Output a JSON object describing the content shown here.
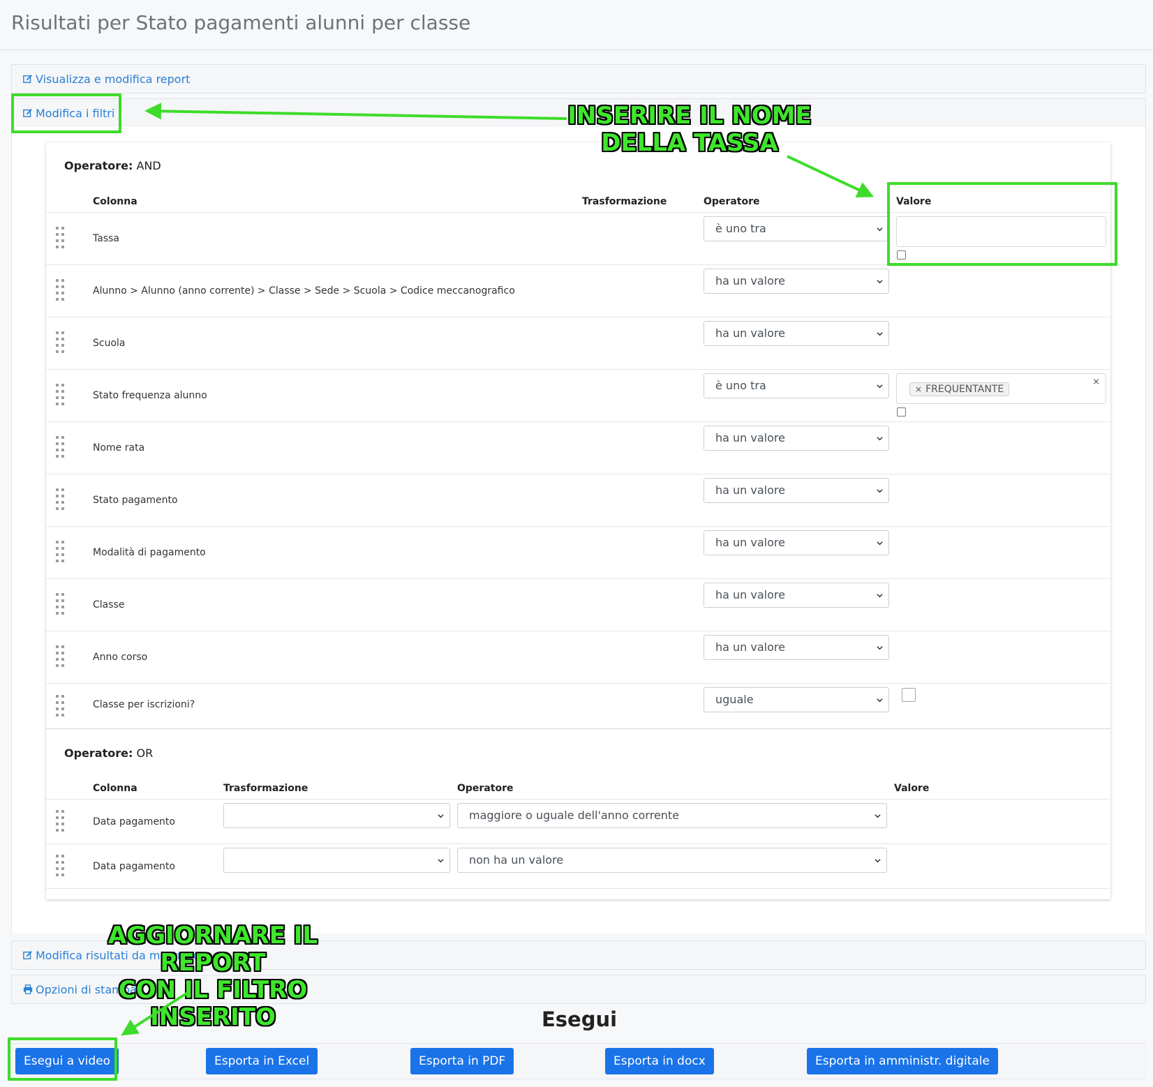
{
  "page": {
    "title": "Risultati per Stato pagamenti alunni per classe"
  },
  "panels": {
    "view_report": "Visualizza e modifica report",
    "edit_filters": "Modifica i filtri",
    "edit_results": "Modifica risultati da mostrare",
    "print_options": "Opzioni di stampa"
  },
  "and_group": {
    "title_label": "Operatore:",
    "title_value": "AND",
    "headers": {
      "column": "Colonna",
      "transform": "Trasformazione",
      "operator": "Operatore",
      "value": "Valore"
    },
    "rows": [
      {
        "column": "Tassa",
        "operator": "è uno tra"
      },
      {
        "column": "Alunno > Alunno (anno corrente) > Classe > Sede > Scuola > Codice meccanografico",
        "operator": "ha un valore"
      },
      {
        "column": "Scuola",
        "operator": "ha un valore"
      },
      {
        "column": "Stato frequenza alunno",
        "operator": "è uno tra",
        "tag": "FREQUENTANTE",
        "tag_remove": "×",
        "clear": "×"
      },
      {
        "column": "Nome rata",
        "operator": "ha un valore"
      },
      {
        "column": "Stato pagamento",
        "operator": "ha un valore"
      },
      {
        "column": "Modalità di pagamento",
        "operator": "ha un valore"
      },
      {
        "column": "Classe",
        "operator": "ha un valore"
      },
      {
        "column": "Anno corso",
        "operator": "ha un valore"
      },
      {
        "column": "Classe per iscrizioni?",
        "operator": "uguale"
      }
    ]
  },
  "or_group": {
    "title_label": "Operatore:",
    "title_value": "OR",
    "headers": {
      "column": "Colonna",
      "transform": "Trasformazione",
      "operator": "Operatore",
      "value": "Valore"
    },
    "rows": [
      {
        "column": "Data pagamento",
        "transform": "",
        "operator": "maggiore o uguale dell'anno corrente"
      },
      {
        "column": "Data pagamento",
        "transform": "",
        "operator": "non ha un valore"
      }
    ]
  },
  "run": {
    "title": "Esegui",
    "buttons": {
      "video": "Esegui a video",
      "excel": "Esporta in Excel",
      "pdf": "Esporta in PDF",
      "docx": "Esporta in docx",
      "digital": "Esporta in amministr. digitale"
    }
  },
  "annotations": {
    "tax_name_line1": "INSERIRE IL NOME",
    "tax_name_line2": "DELLA TASSA",
    "refresh_line1": "AGGIORNARE IL REPORT",
    "refresh_line2": "CON IL FILTRO INSERITO",
    "highlight_color": "#3ddc2a"
  },
  "colors": {
    "link": "#2a7fd4",
    "button": "#1a73e8"
  }
}
